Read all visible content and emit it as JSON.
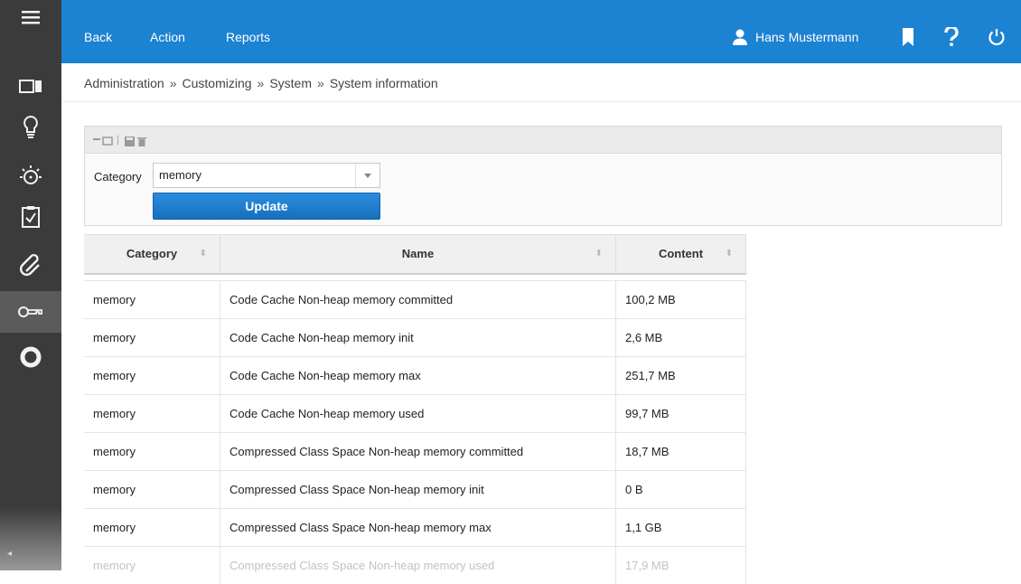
{
  "topbar": {
    "menu": [
      "Back",
      "Action",
      "Reports"
    ],
    "user_name": "Hans Mustermann",
    "icons": [
      "bookmark-icon",
      "help-icon",
      "power-icon"
    ],
    "color": "#1c82d2"
  },
  "sidebar": {
    "items": [
      "menu-icon",
      "dashboard-icon",
      "lightbulb-icon",
      "sun-icon",
      "checklist-icon",
      "attachment-icon",
      "key-icon",
      "help-ring-icon"
    ],
    "active": "key-icon"
  },
  "breadcrumb": [
    "Administration",
    "Customizing",
    "System",
    "System information"
  ],
  "breadcrumb_separator": "»",
  "filter": {
    "category_label": "Category",
    "category_value": "memory",
    "update_label": "Update"
  },
  "table": {
    "headers": [
      "Category",
      "Name",
      "Content"
    ],
    "rows": [
      [
        "memory",
        "Code Cache Non-heap memory committed",
        "100,2 MB"
      ],
      [
        "memory",
        "Code Cache Non-heap memory init",
        "2,6 MB"
      ],
      [
        "memory",
        "Code Cache Non-heap memory max",
        "251,7 MB"
      ],
      [
        "memory",
        "Code Cache Non-heap memory used",
        "99,7 MB"
      ],
      [
        "memory",
        "Compressed Class Space Non-heap memory committed",
        "18,7 MB"
      ],
      [
        "memory",
        "Compressed Class Space Non-heap memory init",
        "0 B"
      ],
      [
        "memory",
        "Compressed Class Space Non-heap memory max",
        "1,1 GB"
      ],
      [
        "memory",
        "Compressed Class Space Non-heap memory used",
        "17,9 MB"
      ]
    ]
  }
}
